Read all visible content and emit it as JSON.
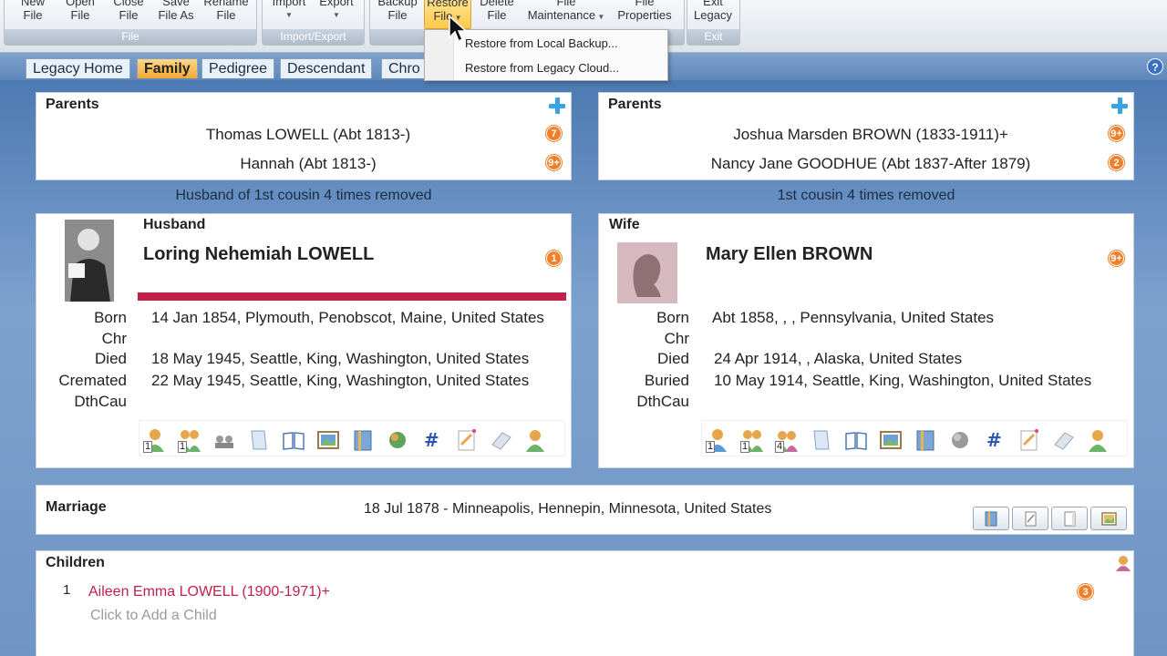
{
  "ribbon": {
    "buttons": [
      {
        "line1": "New",
        "line2": "File"
      },
      {
        "line1": "Open",
        "line2": "File"
      },
      {
        "line1": "Close",
        "line2": "File"
      },
      {
        "line1": "Save",
        "line2": "File As"
      },
      {
        "line1": "Rename",
        "line2": "File"
      },
      {
        "line1": "Import",
        "line2": ""
      },
      {
        "line1": "Export",
        "line2": ""
      },
      {
        "line1": "Backup",
        "line2": "File"
      },
      {
        "line1": "Restore",
        "line2": "File"
      },
      {
        "line1": "Delete",
        "line2": "File"
      },
      {
        "line1": "File",
        "line2": "Maintenance"
      },
      {
        "line1": "File",
        "line2": "Properties"
      },
      {
        "line1": "Exit",
        "line2": "Legacy"
      }
    ],
    "groups": [
      "File",
      "Import/Export",
      "Exit"
    ]
  },
  "menu": {
    "items": [
      "Restore from Local Backup...",
      "Restore from Legacy Cloud..."
    ]
  },
  "tabs": [
    "Legacy Home",
    "Family",
    "Pedigree",
    "Descendant",
    "Chro"
  ],
  "left_parents": {
    "title": "Parents",
    "father": "Thomas LOWELL (Abt 1813-)",
    "father_badge": "7",
    "mother": "Hannah (Abt 1813-)",
    "mother_badge": "9+"
  },
  "right_parents": {
    "title": "Parents",
    "father": "Joshua Marsden BROWN (1833-1911)+",
    "father_badge": "9+",
    "mother": "Nancy Jane GOODHUE (Abt 1837-After 1879)",
    "mother_badge": "2"
  },
  "left_relationship": "Husband of 1st cousin 4 times removed",
  "right_relationship": "1st cousin 4 times removed",
  "husband": {
    "role": "Husband",
    "name": "Loring Nehemiah LOWELL",
    "badge": "1",
    "facts": [
      {
        "label": "Born",
        "value": "14 Jan 1854, Plymouth, Penobscot, Maine, United States"
      },
      {
        "label": "Chr",
        "value": ""
      },
      {
        "label": "Died",
        "value": "18 May 1945, Seattle, King, Washington, United States"
      },
      {
        "label": "Cremated",
        "value": "22 May 1945, Seattle, King, Washington, United States"
      },
      {
        "label": "DthCau",
        "value": ""
      }
    ],
    "icon_numbers": [
      "1",
      "1"
    ]
  },
  "wife": {
    "role": "Wife",
    "name": "Mary Ellen BROWN",
    "badge": "9+",
    "facts": [
      {
        "label": "Born",
        "value": "Abt 1858, , , Pennsylvania, United States"
      },
      {
        "label": "Chr",
        "value": ""
      },
      {
        "label": "Died",
        "value": "24 Apr 1914, , Alaska, United States"
      },
      {
        "label": "Buried",
        "value": "10 May 1914, Seattle, King, Washington, United States"
      },
      {
        "label": "DthCau",
        "value": ""
      }
    ],
    "icon_numbers": [
      "1",
      "1",
      "4"
    ]
  },
  "marriage": {
    "title": "Marriage",
    "value": "18 Jul 1878 - Minneapolis, Hennepin, Minnesota, United States"
  },
  "children": {
    "title": "Children",
    "items": [
      {
        "index": "1",
        "name": "Aileen Emma LOWELL (1900-1971)+",
        "badge": "3"
      }
    ],
    "add_placeholder": "Click to Add a Child"
  },
  "colors": {
    "accent_orange": "#ee7f2b",
    "husband_bar": "#c1204a",
    "child_link": "#c1204a",
    "plus_blue": "#3aa3e3"
  }
}
